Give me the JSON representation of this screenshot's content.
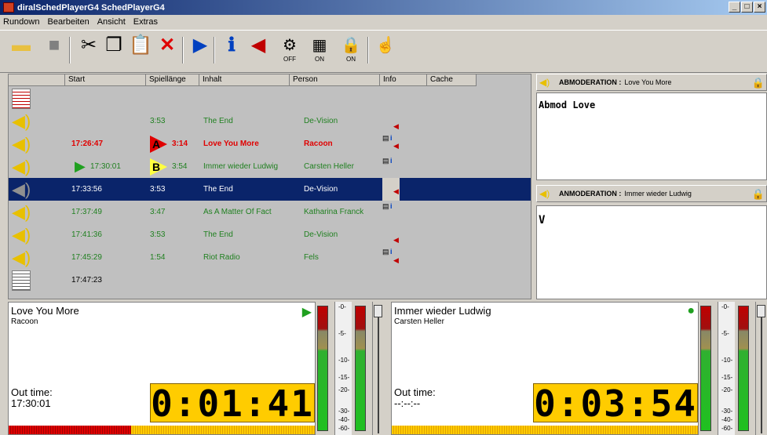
{
  "window": {
    "title": "diralSchedPlayerG4 SchedPlayerG4",
    "controls": [
      "_",
      "□",
      "×"
    ]
  },
  "menu": [
    "Rundown",
    "Bearbeiten",
    "Ansicht",
    "Extras"
  ],
  "toolbar": {
    "off": "OFF",
    "on1": "ON",
    "on2": "ON"
  },
  "columns": [
    "Start",
    "Spiellänge",
    "Inhalt",
    "Person",
    "Info",
    "Cache"
  ],
  "rows": [
    {
      "start": "",
      "len": "",
      "title": "",
      "person": ""
    },
    {
      "start": "",
      "len": "3:53",
      "title": "The End",
      "person": "De-Vision"
    },
    {
      "start": "17:26:47",
      "len": "3:14",
      "title": "Love You More",
      "person": "Racoon",
      "marker": "A"
    },
    {
      "start": "17:30:01",
      "len": "3:54",
      "title": "Immer wieder Ludwig",
      "person": "Carsten Heller",
      "marker": "B"
    },
    {
      "start": "17:33:56",
      "len": "3:53",
      "title": "The End",
      "person": "De-Vision"
    },
    {
      "start": "17:37:49",
      "len": "3:47",
      "title": "As A Matter Of Fact",
      "person": "Katharina Franck"
    },
    {
      "start": "17:41:36",
      "len": "3:53",
      "title": "The End",
      "person": "De-Vision"
    },
    {
      "start": "17:45:29",
      "len": "1:54",
      "title": "Riot Radio",
      "person": "Fels"
    },
    {
      "start": "17:47:23",
      "len": "",
      "title": "",
      "person": ""
    }
  ],
  "abmod": {
    "label": "ABMODERATION :",
    "title": "Love You More",
    "text": "Abmod Love"
  },
  "anmod": {
    "label": "ANMODERATION :",
    "title": "Immer wieder Ludwig",
    "text": "V"
  },
  "player1": {
    "title": "Love You More",
    "artist": "Racoon",
    "out_label": "Out time:",
    "out_time": "17:30:01",
    "clock": "0:01:41",
    "progress": 0.4
  },
  "player2": {
    "title": "Immer wieder Ludwig",
    "artist": "Carsten Heller",
    "out_label": "Out time:",
    "out_time": "--:--:--",
    "clock": "0:03:54",
    "progress": 0.0
  },
  "scale": [
    "-0-",
    "-5-",
    "-10-",
    "-15-",
    "-20-",
    "-30-",
    "-40-",
    "-60-"
  ],
  "colors": {
    "red": "#e00000",
    "green": "#208020",
    "selection": "#0a246a",
    "clock": "#ffcc00"
  }
}
